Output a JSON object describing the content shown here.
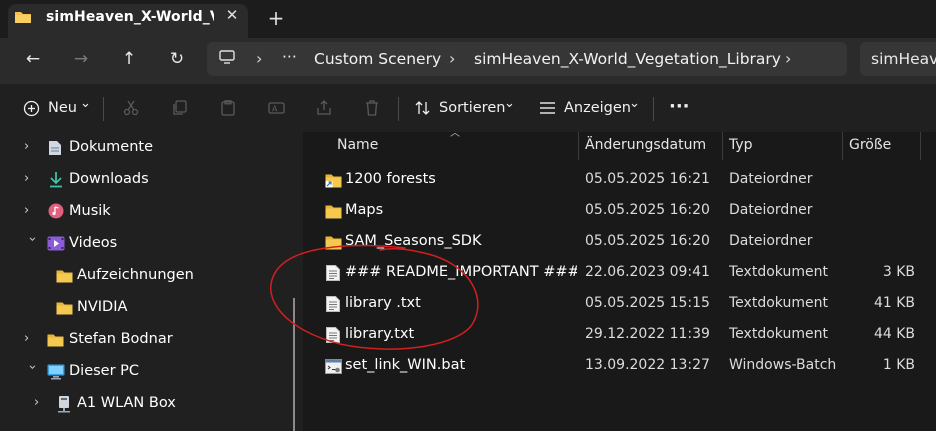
{
  "window": {
    "tab_title": "simHeaven_X-World_Vegetation_Library",
    "tab_close": "✕",
    "new_tab": "+"
  },
  "nav": {
    "back": "←",
    "forward": "→",
    "up": "↑",
    "refresh": "↻"
  },
  "address": {
    "ellipsis": "···",
    "breadcrumbs": [
      "Custom Scenery",
      "simHeaven_X-World_Vegetation_Library"
    ],
    "chevron": "›",
    "search_text": "simHeave"
  },
  "toolbar": {
    "new_label": "Neu",
    "sort_label": "Sortieren",
    "view_label": "Anzeigen",
    "more": "···",
    "dropdown_chevron": "⌄"
  },
  "sidebar": {
    "items": [
      {
        "label": "Dokumente",
        "icon": "document-icon"
      },
      {
        "label": "Downloads",
        "icon": "download-icon"
      },
      {
        "label": "Musik",
        "icon": "music-icon"
      },
      {
        "label": "Videos",
        "icon": "video-icon"
      },
      {
        "label": "Aufzeichnungen",
        "icon": "folder-icon"
      },
      {
        "label": "NVIDIA",
        "icon": "folder-icon"
      },
      {
        "label": "Stefan Bodnar",
        "icon": "folder-icon"
      },
      {
        "label": "Dieser PC",
        "icon": "pc-icon"
      },
      {
        "label": "A1 WLAN Box",
        "icon": "network-drive-icon"
      }
    ]
  },
  "columns": {
    "name": "Name",
    "date": "Änderungsdatum",
    "type": "Typ",
    "size": "Größe"
  },
  "files": [
    {
      "name": "1200 forests",
      "date": "05.05.2025 16:21",
      "type": "Dateiordner",
      "size": "",
      "icon": "folder-link-icon"
    },
    {
      "name": "Maps",
      "date": "05.05.2025 16:20",
      "type": "Dateiordner",
      "size": "",
      "icon": "folder-icon"
    },
    {
      "name": "SAM_Seasons_SDK",
      "date": "05.05.2025 16:20",
      "type": "Dateiordner",
      "size": "",
      "icon": "folder-icon"
    },
    {
      "name": "### README_IMPORTANT ###.txt",
      "date": "22.06.2023 09:41",
      "type": "Textdokument",
      "size": "3 KB",
      "icon": "text-file-icon"
    },
    {
      "name": "library .txt",
      "date": "05.05.2025 15:15",
      "type": "Textdokument",
      "size": "41 KB",
      "icon": "text-file-icon"
    },
    {
      "name": "library.txt",
      "date": "29.12.2022 11:39",
      "type": "Textdokument",
      "size": "44 KB",
      "icon": "text-file-icon"
    },
    {
      "name": "set_link_WIN.bat",
      "date": "13.09.2022 13:27",
      "type": "Windows-Batchdatei",
      "size": "1 KB",
      "icon": "batch-file-icon"
    }
  ],
  "colors": {
    "folder": "#f2c14e",
    "annotation": "#d21f1f",
    "accent": "#4cc2ff"
  }
}
